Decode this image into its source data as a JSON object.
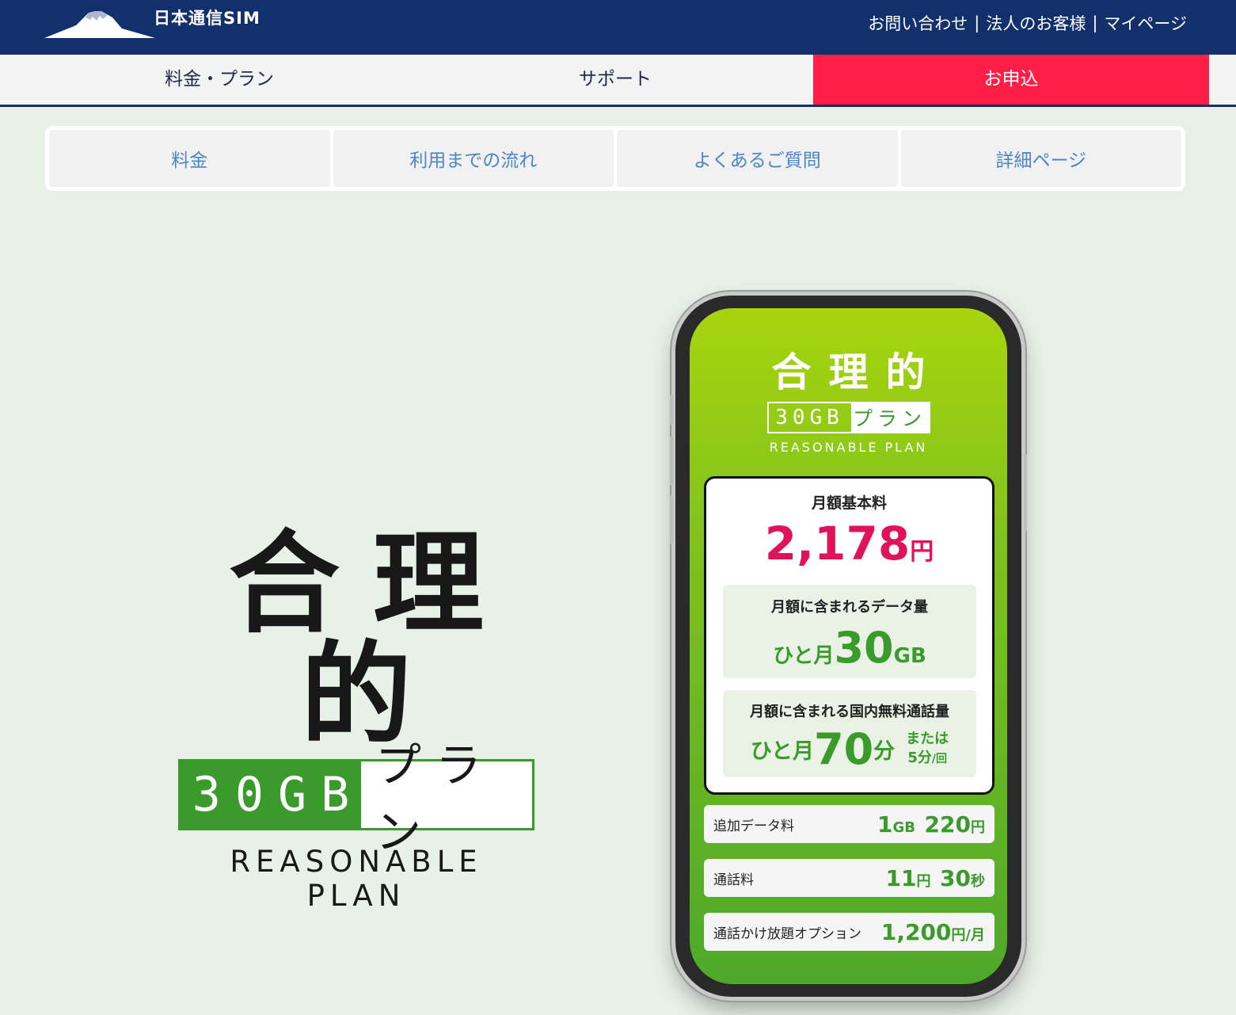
{
  "header": {
    "brand": "日本通信SIM",
    "links": [
      "お問い合わせ",
      "法人のお客様",
      "マイページ"
    ],
    "separator": "|"
  },
  "main_nav": {
    "items": [
      "料金・プラン",
      "サポート",
      "お申込"
    ]
  },
  "sub_nav": {
    "tabs": [
      "料金",
      "利用までの流れ",
      "よくあるご質問",
      "詳細ページ"
    ]
  },
  "hero": {
    "kanji": "合理的",
    "gb": "30GB",
    "plan": "プラン",
    "tagline": "REASONABLE PLAN"
  },
  "phone": {
    "kanji": "合理的",
    "gb": "30GB",
    "plan": "プラン",
    "tagline": "REASONABLE PLAN",
    "monthly_label": "月額基本料",
    "monthly_price": "2,178",
    "yen": "円",
    "data_label": "月額に含まれるデータ量",
    "data_prefix": "ひと月",
    "data_value": "30",
    "data_unit": "GB",
    "call_label": "月額に含まれる国内無料通話量",
    "call_prefix": "ひと月",
    "call_value": "70",
    "call_unit": "分",
    "call_or": "または",
    "call_alt": "5分",
    "call_alt_unit": "/回",
    "rows": [
      {
        "label": "追加データ料",
        "v1": "1",
        "u1": "GB",
        "v2": "220",
        "u2": "円"
      },
      {
        "label": "通話料",
        "v1": "11",
        "u1": "円",
        "v2": "30",
        "u2": "秒"
      },
      {
        "label": "通話かけ放題オプション",
        "v1": "1,200",
        "u1": "円/月"
      }
    ]
  },
  "colors": {
    "header_bg": "#12306b",
    "apply_bg": "#ff1e46",
    "page_bg": "#e8f1e8",
    "accent_green": "#3a9a2c",
    "price_pink": "#e0135a",
    "tab_text": "#4a86c8"
  }
}
